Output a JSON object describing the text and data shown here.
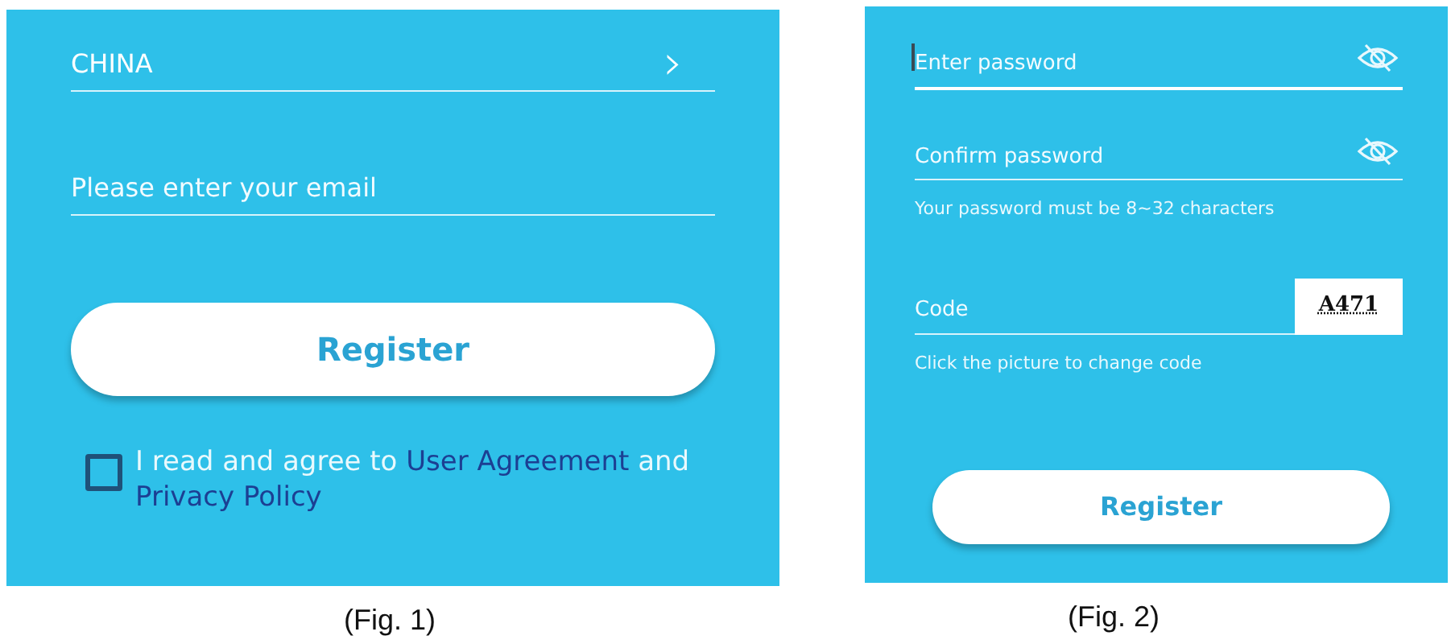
{
  "figures": [
    {
      "caption": "(Fig. 1)",
      "country": {
        "value": "CHINA",
        "chevron": "›"
      },
      "email": {
        "placeholder": "Please enter your email"
      },
      "register": "Register",
      "agreement": {
        "checked": false,
        "text": "I read and agree to ",
        "link1": "User Agreement",
        "middle": " and ",
        "link2": "Privacy Policy"
      }
    },
    {
      "caption": "(Fig. 2)",
      "fields": [
        {
          "kind": "password",
          "placeholder": "Enter password",
          "focused": true
        },
        {
          "kind": "password",
          "placeholder": "Confirm password",
          "focused": false
        },
        {
          "kind": "hint",
          "text": "Your password must be 8~32 characters"
        },
        {
          "kind": "code",
          "placeholder": "Code",
          "focused": false,
          "captcha": "A471"
        },
        {
          "kind": "hint",
          "text": "Click the picture to change code"
        }
      ],
      "register": "Register"
    }
  ]
}
